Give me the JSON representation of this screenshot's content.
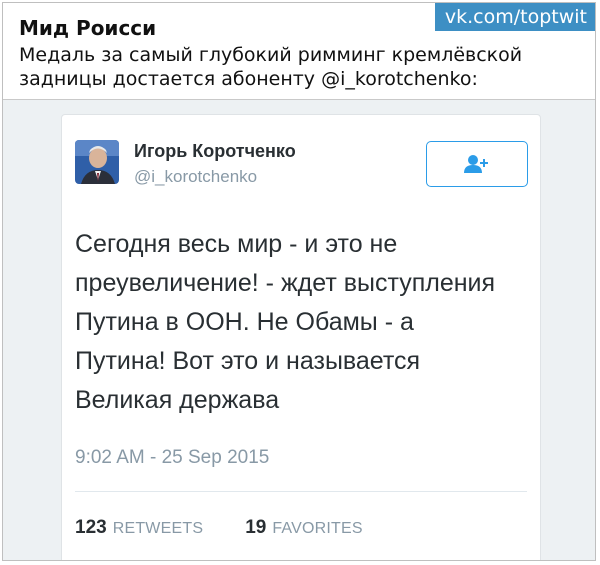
{
  "post": {
    "author": "Мид Роисси",
    "watermark": "vk.com/toptwit",
    "caption": "Медаль за самый глубокий римминг кремлёвской задницы достается абоненту @i_korotchenko:"
  },
  "tweet": {
    "display_name": "Игорь Коротченко",
    "handle": "@i_korotchenko",
    "text": "Сегодня весь мир - и это не\nпреувеличение! - ждет выступления\nПутина в ООН. Не Обамы - а\nПутина! Вот это и называется\nВеликая держава",
    "timestamp": "9:02 AM - 25 Sep 2015",
    "retweets_count": "123",
    "retweets_label": "RETWEETS",
    "favorites_count": "19",
    "favorites_label": "FAVORITES",
    "follow_icon": "add-user-icon"
  },
  "colors": {
    "twitter_blue": "#2b9ce8",
    "watermark_bg": "#3d8fc4",
    "muted_text": "#8899a6",
    "tweet_text": "#292f33"
  }
}
